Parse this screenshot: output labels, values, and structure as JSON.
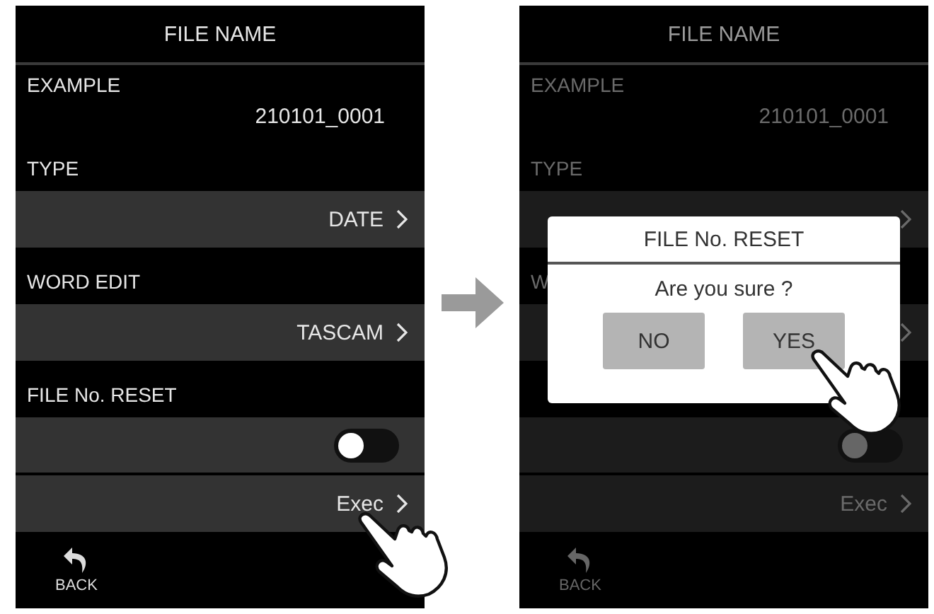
{
  "screens": [
    {
      "title": "FILE NAME",
      "dimmed": false,
      "rows": [
        {
          "kind": "label",
          "text": "EXAMPLE"
        },
        {
          "kind": "value",
          "text": "210101_0001"
        },
        {
          "kind": "label",
          "text": "TYPE"
        },
        {
          "kind": "link",
          "text": "DATE",
          "tapped": false
        },
        {
          "kind": "label",
          "text": "WORD EDIT"
        },
        {
          "kind": "link",
          "text": "TASCAM",
          "tapped": false
        },
        {
          "kind": "label",
          "text": "FILE No. RESET"
        },
        {
          "kind": "toggle",
          "on": false
        },
        {
          "kind": "link",
          "text": "Exec",
          "tapped": true
        }
      ],
      "back": "BACK"
    },
    {
      "title": "FILE NAME",
      "dimmed": true,
      "rows": [
        {
          "kind": "label",
          "text": "EXAMPLE"
        },
        {
          "kind": "value",
          "text": "210101_0001"
        },
        {
          "kind": "label",
          "text": "TYPE"
        },
        {
          "kind": "link",
          "tapped": false
        },
        {
          "kind": "label",
          "text": "W"
        },
        {
          "kind": "link",
          "tapped": false
        },
        {
          "kind": "label"
        },
        {
          "kind": "toggle",
          "on": false
        },
        {
          "kind": "link",
          "text": "Exec",
          "tapped": false
        }
      ],
      "back": "BACK",
      "dialog": {
        "title": "FILE No. RESET",
        "message": "Are you sure ?",
        "buttons": [
          {
            "label": "NO",
            "tapped": false
          },
          {
            "label": "YES",
            "tapped": true
          }
        ]
      }
    }
  ]
}
